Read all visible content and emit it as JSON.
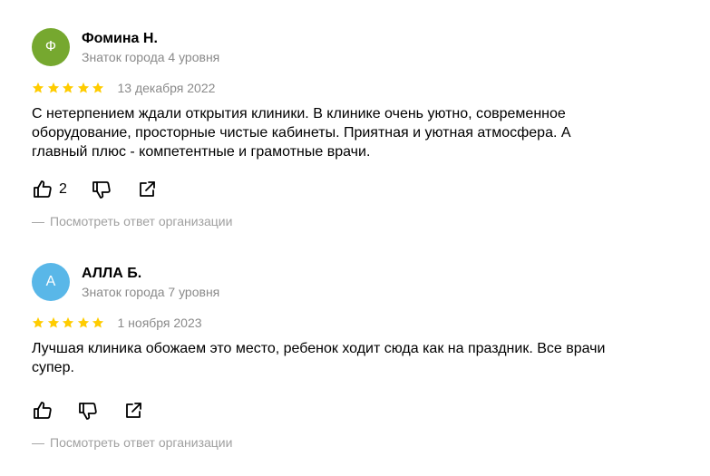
{
  "reviews": [
    {
      "avatar_letter": "Ф",
      "avatar_color": "#76a82f",
      "author": "Фомина Н.",
      "level": "Знаток города 4 уровня",
      "rating": 5,
      "date": "13 декабря 2022",
      "text": "С нетерпением ждали открытия клиники. В клинике очень уютно, современное оборудование, просторные чистые кабинеты. Приятная и уютная атмосфера. А главный плюс - компетентные и грамотные врачи.",
      "likes": "2",
      "org_answer_label": "Посмотреть ответ организации"
    },
    {
      "avatar_letter": "А",
      "avatar_color": "#59b7e8",
      "author": "АЛЛА Б.",
      "level": "Знаток города 7 уровня",
      "rating": 5,
      "date": "1 ноября 2023",
      "text": "Лучшая клиника обожаем это место, ребенок ходит сюда как на праздник. Все врачи супер.",
      "likes": "",
      "org_answer_label": "Посмотреть ответ организации"
    }
  ],
  "icons": {
    "star": "star-icon",
    "like": "thumb-up-icon",
    "dislike": "thumb-down-icon",
    "share": "share-icon"
  },
  "colors": {
    "star": "#fc0",
    "secondary_text": "#8a8a8a",
    "muted_text": "#a0a0a0"
  }
}
